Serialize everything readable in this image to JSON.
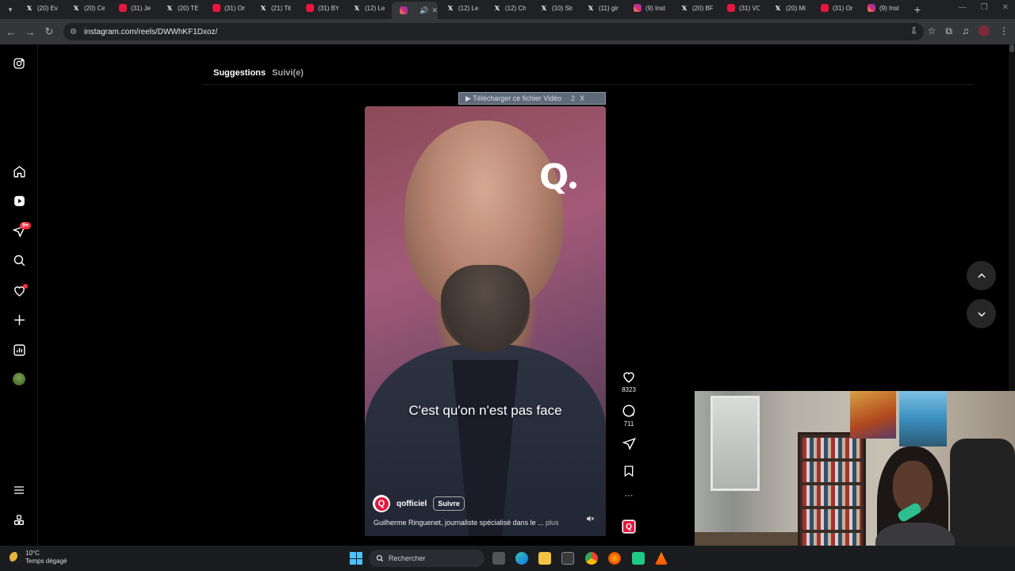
{
  "browser": {
    "tabs": [
      {
        "icon": "x",
        "title": "(20) Ev"
      },
      {
        "icon": "x",
        "title": "(20) Ce"
      },
      {
        "icon": "yt",
        "title": "(31) Je"
      },
      {
        "icon": "x",
        "title": "(20) TE"
      },
      {
        "icon": "yt",
        "title": "(31) On"
      },
      {
        "icon": "x",
        "title": "(21) Tit"
      },
      {
        "icon": "yt",
        "title": "(31) BY"
      },
      {
        "icon": "x",
        "title": "(12) Le"
      },
      {
        "icon": "ig",
        "title": "",
        "active": true
      },
      {
        "icon": "x",
        "title": "(12) Le"
      },
      {
        "icon": "x",
        "title": "(12) Ch"
      },
      {
        "icon": "x",
        "title": "(10) Str"
      },
      {
        "icon": "x",
        "title": "(11) gir"
      },
      {
        "icon": "ig",
        "title": "(9) Inst"
      },
      {
        "icon": "x",
        "title": "(20) BF"
      },
      {
        "icon": "yt",
        "title": "(31) VC"
      },
      {
        "icon": "x",
        "title": "(20) Mi"
      },
      {
        "icon": "yt",
        "title": "(31) Or"
      },
      {
        "icon": "ig",
        "title": "(9) Inst"
      }
    ],
    "new_tab": "+",
    "url": "instagram.com/reels/DWWhKF1Dxoz/"
  },
  "instagram": {
    "nav": {
      "suggestions": "Suggestions",
      "following": "Suivi(e)"
    },
    "notifications_badge": "9+",
    "download_bar": {
      "label": "▶ Télécharger ce fichier Vidéo",
      "number": "2",
      "close": "X"
    },
    "reel": {
      "logo_letter": "Q",
      "subtitle": "C'est qu'on n'est pas face",
      "author": "qofficiel",
      "author_avatar_letter": "Q",
      "follow_label": "Suivre",
      "caption": "Guilherme Ringuenet, journaliste spécialisé dans le ...",
      "caption_more": "plus",
      "likes": "8323",
      "comments": "711",
      "more": "···",
      "audio_letter": "Q"
    }
  },
  "taskbar": {
    "temperature": "10°C",
    "weather": "Temps dégagé",
    "search_placeholder": "Rechercher"
  },
  "colors": {
    "accent_red": "#ff3040",
    "brand_q": "#e3173e",
    "taskbar_blue": "#4cc2ff"
  }
}
